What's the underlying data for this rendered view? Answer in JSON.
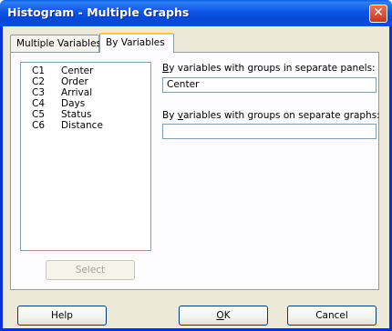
{
  "window": {
    "title": "Histogram - Multiple Graphs",
    "close_glyph": "✕"
  },
  "tabs": [
    {
      "label": "Multiple Variables",
      "active": false
    },
    {
      "label": "By Variables",
      "active": true
    }
  ],
  "variables": [
    {
      "col": "C1",
      "name": "Center"
    },
    {
      "col": "C2",
      "name": "Order"
    },
    {
      "col": "C3",
      "name": "Arrival"
    },
    {
      "col": "C4",
      "name": "Days"
    },
    {
      "col": "C5",
      "name": "Status"
    },
    {
      "col": "C6",
      "name": "Distance"
    }
  ],
  "panels_field": {
    "label_prefix": "",
    "label_underlined": "B",
    "label_suffix": "y variables with groups in separate panels:",
    "value": "Center"
  },
  "graphs_field": {
    "label_prefix": "By ",
    "label_underlined": "v",
    "label_suffix": "ariables with groups on separate graphs:",
    "value": ""
  },
  "buttons": {
    "select": "Select",
    "help": "Help",
    "ok_underlined": "O",
    "ok_rest": "K",
    "cancel": "Cancel"
  },
  "colors": {
    "titlebar": "#0a4fe0",
    "dialog_bg": "#ece9d8",
    "close_button": "#c8361b",
    "active_tab_highlight": "#ffc83c"
  }
}
